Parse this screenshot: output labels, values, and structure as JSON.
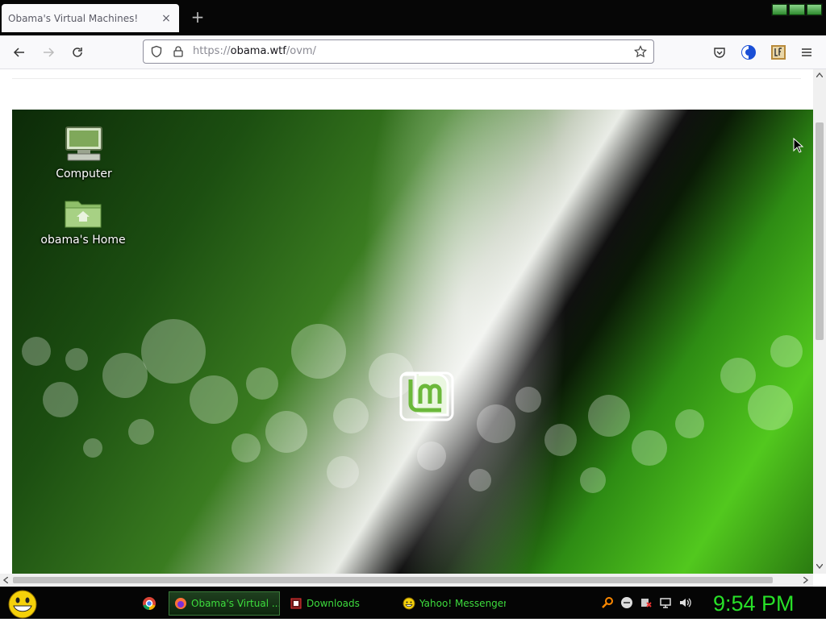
{
  "tab": {
    "title": "Obama's Virtual Machines!",
    "close": "×",
    "new_tab": "+"
  },
  "navbar": {
    "url_scheme": "https://",
    "url_host": "obama.wtf",
    "url_path": "/ovm/"
  },
  "desktop": {
    "icons": [
      {
        "label": "Computer",
        "icon": "computer-icon"
      },
      {
        "label": "obama's Home",
        "icon": "home-folder-icon"
      }
    ],
    "logo": "linux-mint-logo"
  },
  "taskbar": {
    "tasks": [
      {
        "label": "Obama's Virtual ...",
        "icon": "firefox-icon",
        "active": true
      },
      {
        "label": "Downloads",
        "icon": "downloads-folder-icon",
        "active": false
      },
      {
        "label": "Yahoo! Messenger",
        "icon": "yahoo-messenger-icon",
        "active": false
      }
    ],
    "clock": "9:54 PM"
  },
  "colors": {
    "taskbar_text": "#3ddc3d",
    "clock": "#28e028",
    "taskbar_bg": "#050505"
  }
}
